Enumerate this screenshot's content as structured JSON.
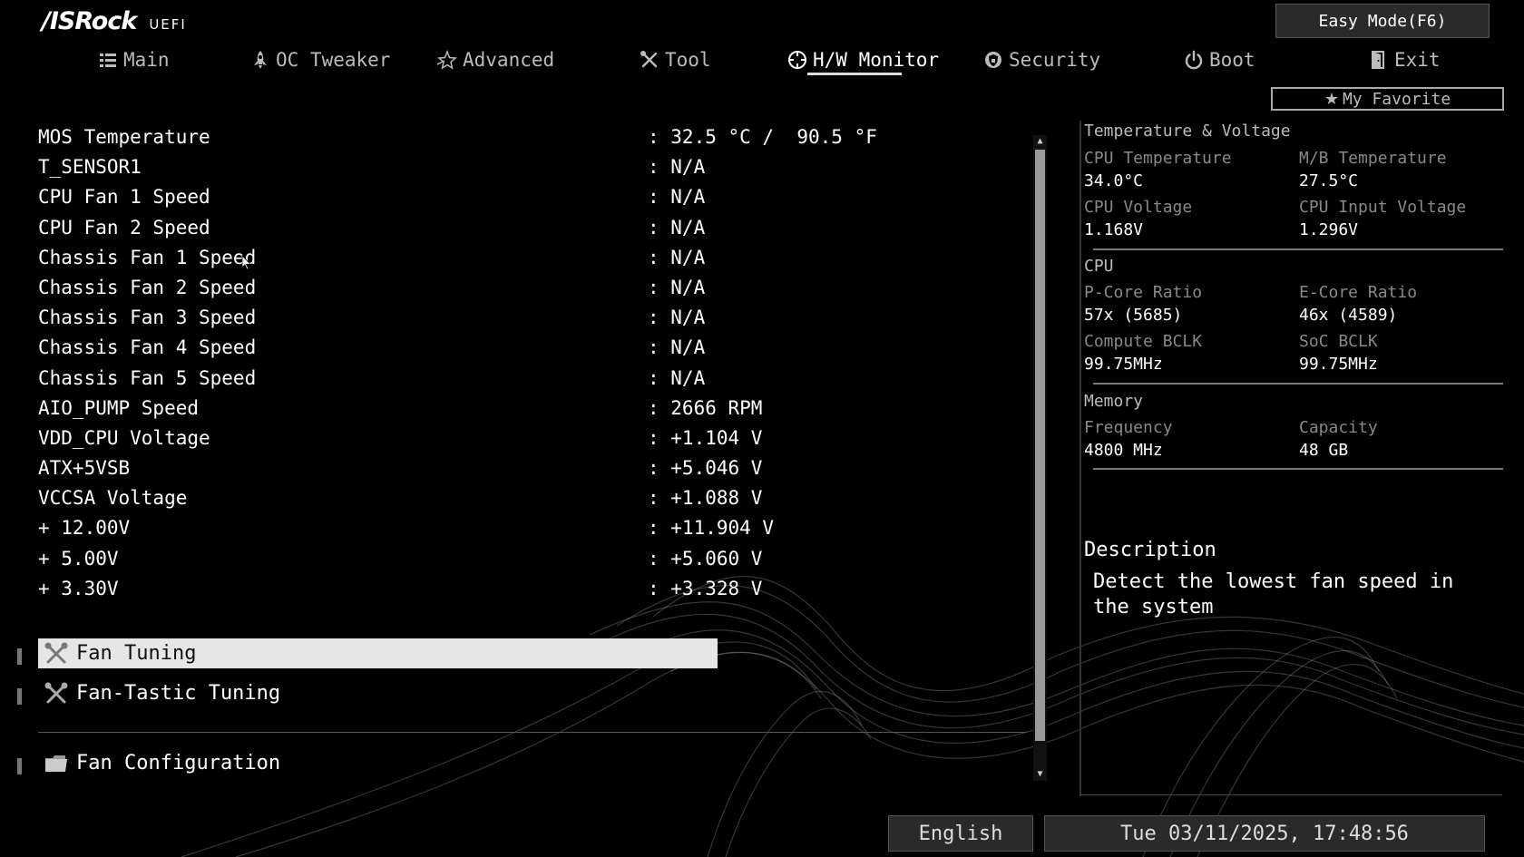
{
  "brand": {
    "logo": "/ISRock",
    "logo_sub": "UEFI"
  },
  "easy_mode_label": "Easy Mode(F6)",
  "nav": [
    {
      "label": "Main",
      "icon": "list-icon"
    },
    {
      "label": "OC Tweaker",
      "icon": "rocket-icon"
    },
    {
      "label": "Advanced",
      "icon": "star-outline-icon"
    },
    {
      "label": "Tool",
      "icon": "tools-icon"
    },
    {
      "label": "H/W Monitor",
      "icon": "monitor-gauge-icon",
      "active": true
    },
    {
      "label": "Security",
      "icon": "shield-icon"
    },
    {
      "label": "Boot",
      "icon": "power-icon"
    },
    {
      "label": "Exit",
      "icon": "exit-door-icon"
    }
  ],
  "favorite_label": "My Favorite",
  "monitor_rows": [
    {
      "label": "MOS Temperature",
      "value": ": 32.5 °C /  90.5 °F"
    },
    {
      "label": "T_SENSOR1",
      "value": ": N/A"
    },
    {
      "label": "CPU Fan 1 Speed",
      "value": ": N/A"
    },
    {
      "label": "CPU Fan 2 Speed",
      "value": ": N/A"
    },
    {
      "label": "Chassis Fan 1 Speed",
      "value": ": N/A"
    },
    {
      "label": "Chassis Fan 2 Speed",
      "value": ": N/A"
    },
    {
      "label": "Chassis Fan 3 Speed",
      "value": ": N/A"
    },
    {
      "label": "Chassis Fan 4 Speed",
      "value": ": N/A"
    },
    {
      "label": "Chassis Fan 5 Speed",
      "value": ": N/A"
    },
    {
      "label": "AIO_PUMP Speed",
      "value": ": 2666 RPM"
    },
    {
      "label": "VDD_CPU Voltage",
      "value": ": +1.104 V"
    },
    {
      "label": "ATX+5VSB",
      "value": ": +5.046 V"
    },
    {
      "label": "VCCSA Voltage",
      "value": ": +1.088 V"
    },
    {
      "label": "+ 12.00V",
      "value": ": +11.904 V"
    },
    {
      "label": "+ 5.00V",
      "value": ": +5.060 V"
    },
    {
      "label": "+ 3.30V",
      "value": ": +3.328 V"
    }
  ],
  "menu": [
    {
      "label": "Fan Tuning",
      "icon": "tools-icon"
    },
    {
      "label": "Fan-Tastic Tuning",
      "icon": "tools-icon"
    },
    {
      "label": "Fan Configuration",
      "icon": "folder-icon"
    }
  ],
  "panel": {
    "temp_voltage": {
      "title": "Temperature & Voltage",
      "cpu_temp_label": "CPU Temperature",
      "cpu_temp": "34.0°C",
      "mb_temp_label": "M/B Temperature",
      "mb_temp": "27.5°C",
      "cpu_voltage_label": "CPU Voltage",
      "cpu_voltage": "1.168V",
      "cpu_input_voltage_label": "CPU Input Voltage",
      "cpu_input_voltage": "1.296V"
    },
    "cpu": {
      "title": "CPU",
      "pcore_label": "P-Core Ratio",
      "pcore": "57x (5685)",
      "ecore_label": "E-Core Ratio",
      "ecore": "46x (4589)",
      "bclk_label": "Compute BCLK",
      "bclk": "99.75MHz",
      "soc_label": "SoC BCLK",
      "soc": "99.75MHz"
    },
    "memory": {
      "title": "Memory",
      "freq_label": "Frequency",
      "freq": "4800 MHz",
      "cap_label": "Capacity",
      "cap": "48 GB"
    }
  },
  "description": {
    "title": "Description",
    "text": "Detect the lowest fan speed in the system"
  },
  "footer": {
    "language": "English",
    "datetime": "Tue 03/11/2025, 17:48:56"
  },
  "colors": {
    "background": "#000000",
    "selection": "#e6e6e6",
    "text": "#ffffff",
    "muted": "#888888"
  }
}
